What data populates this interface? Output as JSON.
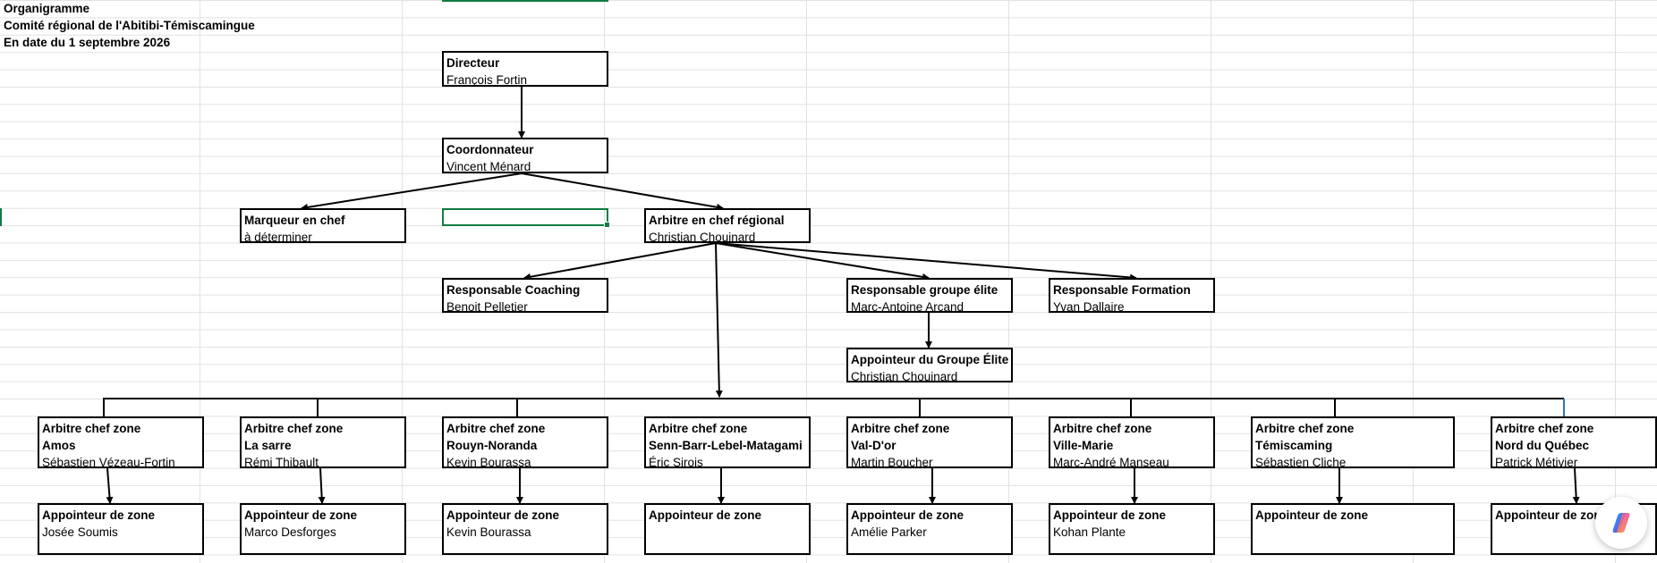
{
  "header": {
    "title": "Organigramme",
    "committee": "Comité régional de l'Abitibi-Témiscamingue",
    "date": "En date du 1 septembre 2026"
  },
  "chart": {
    "directeur": {
      "title": "Directeur",
      "name": "François Fortin"
    },
    "coordonnateur": {
      "title": "Coordonnateur",
      "name": "Vincent Ménard"
    },
    "marqueur": {
      "title": "Marqueur en chef",
      "name": "à déterminer"
    },
    "arbitre_chef": {
      "title": "Arbitre en chef régional",
      "name": "Christian Chouinard"
    },
    "coaching": {
      "title": "Responsable Coaching",
      "name": "Benoit Pelletier"
    },
    "elite": {
      "title": "Responsable groupe élite",
      "name": "Marc-Antoine Arcand"
    },
    "formation": {
      "title": "Responsable Formation",
      "name": "Yvan Dallaire"
    },
    "appointeur_elite": {
      "title": "Appointeur du Groupe Élite",
      "name": "Christian  Chouinard"
    },
    "zone_title": "Arbitre chef  zone",
    "appointeur_title": "Appointeur de zone",
    "zones": [
      {
        "zone": "Amos",
        "chef": "Sébastien Vézeau-Fortin",
        "appointeur": "Josée Soumis"
      },
      {
        "zone": "La sarre",
        "chef": "Rémi Thibault",
        "appointeur": "Marco Desforges"
      },
      {
        "zone": "Rouyn-Noranda",
        "chef": "Kevin Bourassa",
        "appointeur": "Kevin Bourassa"
      },
      {
        "zone": "Senn-Barr-Lebel-Matagami",
        "chef": "Éric Sirois",
        "appointeur": ""
      },
      {
        "zone": "Val-D'or",
        "chef": "Martin Boucher",
        "appointeur": "Amélie Parker"
      },
      {
        "zone": "Ville-Marie",
        "chef": "Marc-André Manseau",
        "appointeur": "Kohan Plante"
      },
      {
        "zone": "Témiscaming",
        "chef": "Sébastien Cliche",
        "appointeur": ""
      },
      {
        "zone": "Nord du Québec",
        "chef": "Patrick Métivier",
        "appointeur": ""
      }
    ]
  },
  "ui": {
    "accent": "#107c41",
    "copilot_icon": "copilot-icon"
  }
}
